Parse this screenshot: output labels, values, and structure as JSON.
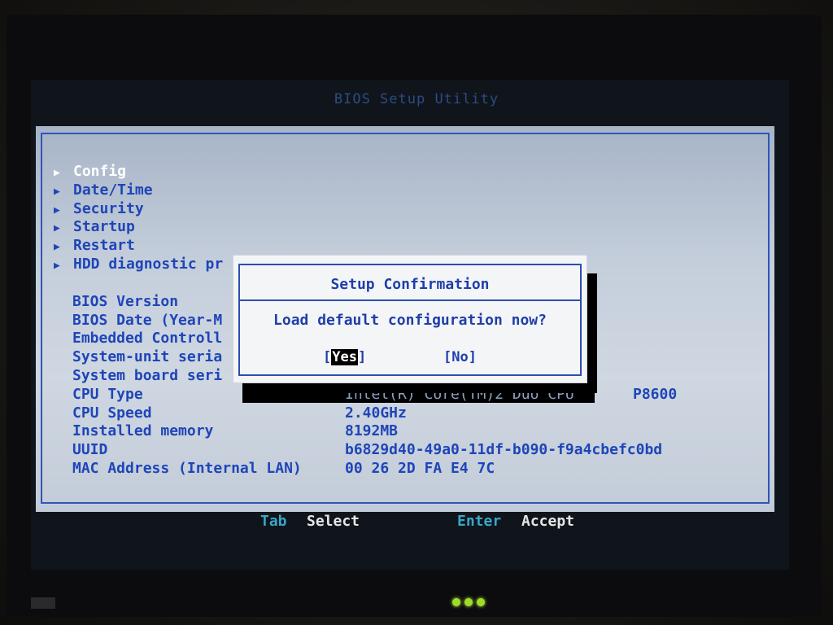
{
  "window": {
    "title": "BIOS Setup Utility"
  },
  "menu": {
    "items": [
      {
        "label": "Config",
        "selected": true
      },
      {
        "label": "Date/Time",
        "selected": false
      },
      {
        "label": "Security",
        "selected": false
      },
      {
        "label": "Startup",
        "selected": false
      },
      {
        "label": "Restart",
        "selected": false
      },
      {
        "label": "HDD diagnostic pr",
        "selected": false
      }
    ],
    "arrow_icon": "triangle-right-icon"
  },
  "info": {
    "labels": {
      "bios_version": "BIOS Version",
      "bios_date": "BIOS Date (Year-M",
      "ec": "Embedded Controll",
      "serial": "System-unit seria",
      "board": "System board seri",
      "cpu_type": "CPU Type",
      "cpu_speed": "CPU Speed",
      "memory": "Installed memory",
      "uuid": "UUID",
      "mac": "MAC Address (Internal LAN)"
    },
    "values": {
      "cpu_type": "Intel(R) Core(TM)2 Duo CPU",
      "cpu_model": "P8600",
      "cpu_speed": "2.40GHz",
      "memory": "8192MB",
      "uuid": "b6829d40-49a0-11df-b090-f9a4cbefc0bd",
      "mac": "00 26 2D FA E4 7C"
    }
  },
  "dialog": {
    "title": "Setup Confirmation",
    "message": "Load default configuration now?",
    "yes_label": "Yes",
    "no_label": "[No]",
    "bracket_open": "[",
    "bracket_close": "]",
    "selected": "yes"
  },
  "footer": {
    "tab_key": "Tab",
    "tab_action": "Select",
    "enter_key": "Enter",
    "enter_action": "Accept"
  },
  "colors": {
    "panel_bg": "#c4cedb",
    "text_blue": "#1f45b8",
    "key_cyan": "#3aa6c9",
    "led_green": "#9fdc2a"
  }
}
